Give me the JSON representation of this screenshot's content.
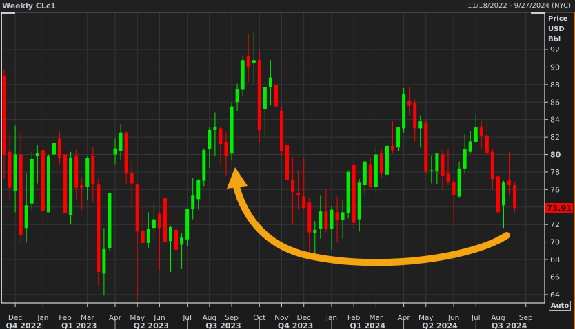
{
  "header": {
    "title": "Weekly CLc1",
    "range": "11/18/2022 - 9/27/2024 (NYC)"
  },
  "axis": {
    "label_lines": [
      "Price",
      "USD",
      "Bbl"
    ],
    "auto_button": "Auto"
  },
  "colors": {
    "up": "#00ee00",
    "down": "#ff0000",
    "annotation": "#f5a511",
    "last_price_bg": "#ff0000",
    "grid": "#363636"
  },
  "chart_data": {
    "type": "candlestick",
    "title": "Weekly CLc1",
    "ylabel": "Price USD Bbl",
    "ylim": [
      62.5,
      95
    ],
    "yticks": [
      64,
      66,
      68,
      70,
      72,
      74,
      76,
      78,
      80,
      82,
      84,
      86,
      88,
      90,
      92
    ],
    "last_price": "73.91",
    "grid": true,
    "ohlc": [
      [
        89.0,
        89.8,
        77.2,
        80.0
      ],
      [
        80.3,
        82.3,
        74.9,
        76.2
      ],
      [
        75.8,
        83.3,
        73.4,
        80.0
      ],
      [
        80.0,
        82.7,
        69.9,
        70.8
      ],
      [
        71.6,
        77.8,
        70.0,
        74.2
      ],
      [
        74.4,
        80.3,
        73.7,
        79.5
      ],
      [
        79.8,
        81.1,
        76.7,
        80.2
      ],
      [
        80.5,
        81.5,
        72.4,
        73.6
      ],
      [
        73.4,
        80.0,
        73.4,
        79.8
      ],
      [
        80.0,
        82.3,
        78.0,
        81.3
      ],
      [
        81.8,
        82.6,
        78.9,
        79.6
      ],
      [
        80.0,
        80.4,
        73.0,
        73.3
      ],
      [
        73.1,
        80.3,
        72.1,
        79.6
      ],
      [
        79.9,
        80.6,
        74.9,
        76.2
      ],
      [
        76.5,
        77.4,
        73.7,
        76.2
      ],
      [
        76.3,
        79.9,
        74.8,
        79.6
      ],
      [
        79.9,
        80.9,
        74.6,
        76.6
      ],
      [
        76.6,
        77.4,
        65.0,
        66.6
      ],
      [
        66.4,
        71.6,
        63.9,
        69.2
      ],
      [
        69.3,
        75.6,
        69.0,
        75.6
      ],
      [
        80.0,
        81.8,
        78.9,
        80.7
      ],
      [
        80.4,
        83.5,
        79.3,
        82.5
      ],
      [
        82.5,
        82.7,
        76.6,
        77.8
      ],
      [
        77.9,
        79.2,
        73.8,
        76.7
      ],
      [
        76.6,
        76.6,
        63.4,
        71.2
      ],
      [
        71.3,
        73.8,
        69.7,
        69.9
      ],
      [
        69.9,
        73.4,
        69.3,
        71.5
      ],
      [
        71.6,
        74.7,
        70.4,
        72.6
      ],
      [
        73.2,
        73.5,
        66.8,
        71.6
      ],
      [
        75.0,
        75.0,
        68.9,
        70.0
      ],
      [
        70.1,
        71.8,
        66.6,
        71.7
      ],
      [
        71.4,
        72.7,
        67.1,
        69.1
      ],
      [
        69.7,
        71.0,
        66.9,
        70.5
      ],
      [
        70.3,
        73.8,
        69.5,
        73.8
      ],
      [
        73.8,
        77.3,
        72.6,
        75.3
      ],
      [
        74.9,
        77.2,
        73.7,
        77.1
      ],
      [
        77.0,
        80.7,
        76.4,
        80.5
      ],
      [
        80.6,
        83.2,
        78.5,
        82.8
      ],
      [
        82.8,
        84.8,
        79.8,
        83.2
      ],
      [
        83.0,
        83.2,
        78.9,
        81.2
      ],
      [
        81.4,
        82.5,
        77.5,
        79.8
      ],
      [
        80.1,
        86.0,
        79.3,
        85.5
      ],
      [
        86.0,
        88.1,
        85.0,
        87.5
      ],
      [
        87.4,
        91.2,
        86.7,
        90.8
      ],
      [
        91.2,
        93.7,
        88.3,
        90.0
      ],
      [
        90.5,
        94.1,
        88.1,
        90.8
      ],
      [
        90.8,
        91.9,
        81.4,
        82.8
      ],
      [
        85.2,
        87.8,
        82.2,
        87.7
      ],
      [
        87.7,
        90.8,
        85.6,
        88.8
      ],
      [
        88.0,
        88.3,
        82.1,
        85.5
      ],
      [
        85.0,
        85.4,
        79.9,
        80.4
      ],
      [
        81.1,
        82.2,
        74.8,
        77.1
      ],
      [
        77.1,
        79.7,
        72.0,
        75.7
      ],
      [
        75.6,
        78.2,
        73.7,
        75.4
      ],
      [
        75.2,
        79.6,
        73.8,
        73.9
      ],
      [
        74.5,
        75.0,
        68.8,
        71.1
      ],
      [
        71.0,
        72.4,
        68.6,
        71.4
      ],
      [
        71.5,
        75.3,
        70.4,
        73.5
      ],
      [
        73.5,
        76.1,
        71.1,
        71.5
      ],
      [
        71.5,
        74.1,
        69.1,
        73.7
      ],
      [
        73.4,
        75.2,
        70.0,
        72.5
      ],
      [
        72.5,
        74.8,
        70.4,
        73.4
      ],
      [
        73.3,
        78.2,
        72.7,
        78.0
      ],
      [
        78.8,
        79.2,
        71.5,
        72.2
      ],
      [
        72.6,
        77.2,
        71.2,
        76.8
      ],
      [
        76.5,
        79.3,
        75.4,
        79.2
      ],
      [
        78.9,
        79.7,
        76.2,
        76.3
      ],
      [
        76.3,
        80.8,
        75.7,
        80.0
      ],
      [
        80.1,
        80.6,
        77.4,
        77.9
      ],
      [
        77.7,
        81.6,
        76.7,
        81.0
      ],
      [
        81.0,
        83.8,
        80.2,
        80.5
      ],
      [
        80.8,
        83.2,
        80.4,
        83.1
      ],
      [
        83.0,
        87.6,
        82.5,
        86.9
      ],
      [
        86.1,
        87.7,
        84.5,
        85.6
      ],
      [
        85.9,
        86.3,
        81.5,
        83.0
      ],
      [
        83.0,
        84.5,
        80.8,
        83.8
      ],
      [
        83.7,
        83.9,
        77.8,
        78.0
      ],
      [
        78.1,
        79.9,
        76.7,
        78.2
      ],
      [
        78.1,
        80.1,
        76.6,
        80.1
      ],
      [
        80.0,
        80.6,
        76.0,
        77.6
      ],
      [
        77.8,
        80.6,
        76.5,
        76.9
      ],
      [
        76.9,
        77.4,
        72.3,
        75.4
      ],
      [
        75.2,
        79.2,
        75.1,
        78.4
      ],
      [
        78.4,
        82.4,
        77.8,
        80.6
      ],
      [
        80.3,
        82.7,
        80.1,
        81.5
      ],
      [
        81.4,
        84.6,
        81.3,
        83.1
      ],
      [
        83.1,
        83.8,
        80.7,
        82.1
      ],
      [
        82.2,
        83.9,
        79.9,
        80.1
      ],
      [
        80.3,
        80.6,
        76.0,
        77.2
      ],
      [
        77.5,
        78.9,
        72.8,
        73.4
      ],
      [
        74.2,
        77.0,
        71.6,
        76.8
      ],
      [
        77.0,
        80.3,
        75.4,
        76.5
      ],
      [
        76.5,
        76.8,
        73.4,
        73.91
      ]
    ],
    "months": [
      {
        "label": "Dec",
        "week": 2
      },
      {
        "label": "Jan",
        "week": 7
      },
      {
        "label": "Feb",
        "week": 11
      },
      {
        "label": "Mar",
        "week": 15
      },
      {
        "label": "Apr",
        "week": 20
      },
      {
        "label": "May",
        "week": 24
      },
      {
        "label": "Jun",
        "week": 28
      },
      {
        "label": "Jul",
        "week": 33
      },
      {
        "label": "Aug",
        "week": 37
      },
      {
        "label": "Sep",
        "week": 41
      },
      {
        "label": "Oct",
        "week": 46
      },
      {
        "label": "Nov",
        "week": 50
      },
      {
        "label": "Dec",
        "week": 54
      },
      {
        "label": "Jan",
        "week": 59
      },
      {
        "label": "Feb",
        "week": 63
      },
      {
        "label": "Mar",
        "week": 67
      },
      {
        "label": "Apr",
        "week": 72
      },
      {
        "label": "May",
        "week": 76
      },
      {
        "label": "Jun",
        "week": 81
      },
      {
        "label": "Jul",
        "week": 85
      },
      {
        "label": "Aug",
        "week": 89
      },
      {
        "label": "Sep",
        "week": 94
      }
    ],
    "quarters": [
      {
        "label": "Q4 2022",
        "start": 0,
        "end": 7
      },
      {
        "label": "Q1 2023",
        "start": 7,
        "end": 20
      },
      {
        "label": "Q2 2023",
        "start": 20,
        "end": 33
      },
      {
        "label": "Q3 2023",
        "start": 33,
        "end": 46
      },
      {
        "label": "Q4 2023",
        "start": 46,
        "end": 59
      },
      {
        "label": "Q1 2024",
        "start": 59,
        "end": 72
      },
      {
        "label": "Q2 2024",
        "start": 72,
        "end": 85
      },
      {
        "label": "Q3 2024",
        "start": 85,
        "end": 97
      }
    ]
  }
}
